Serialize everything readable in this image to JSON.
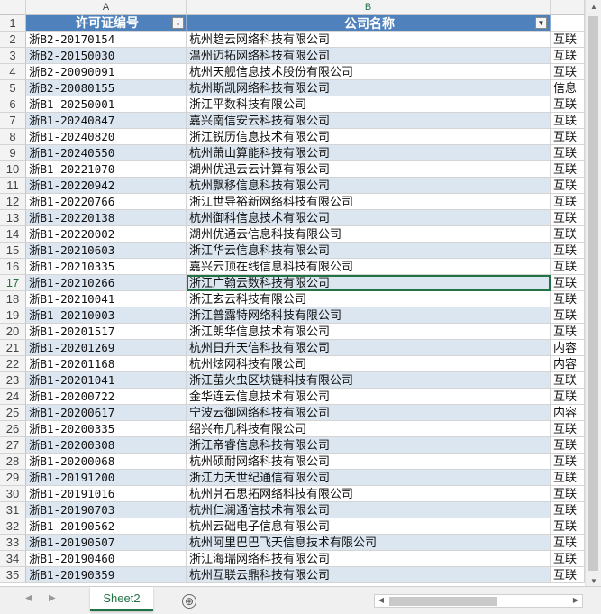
{
  "columns": {
    "a": "A",
    "b": "B"
  },
  "header": {
    "row": "1",
    "col_a": "许可证编号",
    "col_b": "公司名称",
    "filter_a_icon": "sort-filter-icon",
    "filter_b_icon": "filter-dropdown-icon"
  },
  "rows": [
    {
      "n": "2",
      "a": "浙B2-20170154",
      "b": "杭州趋云网络科技有限公司",
      "c": "互联"
    },
    {
      "n": "3",
      "a": "浙B2-20150030",
      "b": "温州迈拓网络科技有限公司",
      "c": "互联"
    },
    {
      "n": "4",
      "a": "浙B2-20090091",
      "b": "杭州天舰信息技术股份有限公司",
      "c": "互联"
    },
    {
      "n": "5",
      "a": "浙B2-20080155",
      "b": "杭州斯凯网络科技有限公司",
      "c": "信息"
    },
    {
      "n": "6",
      "a": "浙B1-20250001",
      "b": "浙江平数科技有限公司",
      "c": "互联"
    },
    {
      "n": "7",
      "a": "浙B1-20240847",
      "b": "嘉兴南信安云科技有限公司",
      "c": "互联"
    },
    {
      "n": "8",
      "a": "浙B1-20240820",
      "b": "浙江锐历信息技术有限公司",
      "c": "互联"
    },
    {
      "n": "9",
      "a": "浙B1-20240550",
      "b": "杭州萧山算能科技有限公司",
      "c": "互联"
    },
    {
      "n": "10",
      "a": "浙B1-20221070",
      "b": "湖州优迅云云计算有限公司",
      "c": "互联"
    },
    {
      "n": "11",
      "a": "浙B1-20220942",
      "b": "杭州飘移信息科技有限公司",
      "c": "互联"
    },
    {
      "n": "12",
      "a": "浙B1-20220766",
      "b": "浙江世导裕新网络科技有限公司",
      "c": "互联"
    },
    {
      "n": "13",
      "a": "浙B1-20220138",
      "b": "杭州御科信息技术有限公司",
      "c": "互联"
    },
    {
      "n": "14",
      "a": "浙B1-20220002",
      "b": "湖州优通云信息科技有限公司",
      "c": "互联"
    },
    {
      "n": "15",
      "a": "浙B1-20210603",
      "b": "浙江华云信息科技有限公司",
      "c": "互联"
    },
    {
      "n": "16",
      "a": "浙B1-20210335",
      "b": "嘉兴云顶在线信息科技有限公司",
      "c": "互联"
    },
    {
      "n": "17",
      "a": "浙B1-20210266",
      "b": "浙江广翰云数科技有限公司",
      "c": "互联"
    },
    {
      "n": "18",
      "a": "浙B1-20210041",
      "b": "浙江玄云科技有限公司",
      "c": "互联"
    },
    {
      "n": "19",
      "a": "浙B1-20210003",
      "b": "浙江普露特网络科技有限公司",
      "c": "互联"
    },
    {
      "n": "20",
      "a": "浙B1-20201517",
      "b": "浙江朗华信息技术有限公司",
      "c": "互联"
    },
    {
      "n": "21",
      "a": "浙B1-20201269",
      "b": "杭州日升天信科技有限公司",
      "c": "内容"
    },
    {
      "n": "22",
      "a": "浙B1-20201168",
      "b": "杭州炫网科技有限公司",
      "c": "内容"
    },
    {
      "n": "23",
      "a": "浙B1-20201041",
      "b": "浙江萤火虫区块链科技有限公司",
      "c": "互联"
    },
    {
      "n": "24",
      "a": "浙B1-20200722",
      "b": "金华连云信息技术有限公司",
      "c": "互联"
    },
    {
      "n": "25",
      "a": "浙B1-20200617",
      "b": "宁波云御网络科技有限公司",
      "c": "内容"
    },
    {
      "n": "26",
      "a": "浙B1-20200335",
      "b": "绍兴布几科技有限公司",
      "c": "互联"
    },
    {
      "n": "27",
      "a": "浙B1-20200308",
      "b": "浙江帝睿信息科技有限公司",
      "c": "互联"
    },
    {
      "n": "28",
      "a": "浙B1-20200068",
      "b": "杭州硕耐网络科技有限公司",
      "c": "互联"
    },
    {
      "n": "29",
      "a": "浙B1-20191200",
      "b": "浙江力天世纪通信有限公司",
      "c": "互联"
    },
    {
      "n": "30",
      "a": "浙B1-20191016",
      "b": "杭州爿石思拓网络科技有限公司",
      "c": "互联"
    },
    {
      "n": "31",
      "a": "浙B1-20190703",
      "b": "杭州仁澜通信技术有限公司",
      "c": "互联"
    },
    {
      "n": "32",
      "a": "浙B1-20190562",
      "b": "杭州云础电子信息有限公司",
      "c": "互联"
    },
    {
      "n": "33",
      "a": "浙B1-20190507",
      "b": "杭州阿里巴巴飞天信息技术有限公司",
      "c": "互联"
    },
    {
      "n": "34",
      "a": "浙B1-20190460",
      "b": "浙江海瑞网络科技有限公司",
      "c": "互联"
    },
    {
      "n": "35",
      "a": "浙B1-20190359",
      "b": "杭州互联云鼎科技有限公司",
      "c": "互联"
    }
  ],
  "selected_row": "17",
  "status": {
    "sheet_tab": "Sheet2",
    "add_sheet": "⊕",
    "prev_icon": "prev-sheet-icon",
    "next_icon": "next-sheet-icon"
  },
  "colors": {
    "header_bg": "#4f81bd",
    "band": "#dce6f1",
    "selection": "#217346"
  }
}
